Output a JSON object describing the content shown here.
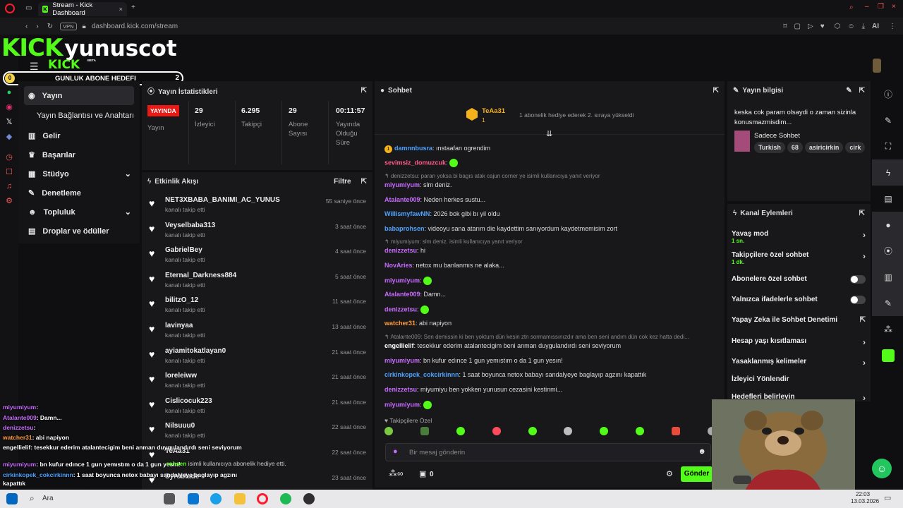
{
  "browser": {
    "tab_title": "Stream - Kick Dashboard",
    "vpn_label": "VPN",
    "url": "dashboard.kick.com/stream",
    "ai_label": "AI"
  },
  "overlay": {
    "brand_logo": "KICK",
    "channel_name": "yunuscot",
    "brand_sub": "KICK",
    "beta_label": "BETA",
    "goal_label": "GUNLUK ABONE HEDEFI",
    "goal_current": "0",
    "goal_target": "2"
  },
  "nav": {
    "items": [
      {
        "label": "Yayın",
        "icon": "radio-icon"
      },
      {
        "label": "Yayın Bağlantısı ve Anahtarı",
        "icon": ""
      },
      {
        "label": "Gelir",
        "icon": "chart-icon"
      },
      {
        "label": "Başarılar",
        "icon": "trophy-icon"
      },
      {
        "label": "Stüdyo",
        "icon": "grid-icon"
      },
      {
        "label": "Denetleme",
        "icon": "wrench-icon"
      },
      {
        "label": "Topluluk",
        "icon": "people-icon"
      },
      {
        "label": "Droplar ve ödüller",
        "icon": "gift-icon"
      }
    ]
  },
  "stats_panel": {
    "title": "Yayın İstatistikleri",
    "live_badge": "YAYINDA",
    "live_label": "Yayın",
    "viewers_value": "29",
    "viewers_label": "İzleyici",
    "followers_value": "6.295",
    "followers_label": "Takipçi",
    "subs_value": "29",
    "subs_label": "Abone Sayısı",
    "uptime_value": "00:11:57",
    "uptime_label": "Yayında Olduğu Süre"
  },
  "activity": {
    "title": "Etkinlik Akışı",
    "filter_label": "Filtre",
    "items": [
      {
        "name": "NET3XBABA_BANIMI_AC_YUNUS",
        "action": "kanalı takip etti",
        "time": "55 saniye önce"
      },
      {
        "name": "Veyselbaba313",
        "action": "kanalı takip etti",
        "time": "3 saat önce"
      },
      {
        "name": "GabrielBey",
        "action": "kanalı takip etti",
        "time": "4 saat önce"
      },
      {
        "name": "Eternal_Darkness884",
        "action": "kanalı takip etti",
        "time": "5 saat önce"
      },
      {
        "name": "bilitzO_12",
        "action": "kanalı takip etti",
        "time": "11 saat önce"
      },
      {
        "name": "lavinyaa",
        "action": "kanalı takip etti",
        "time": "13 saat önce"
      },
      {
        "name": "ayiamitokatlayan0",
        "action": "kanalı takip etti",
        "time": "21 saat önce"
      },
      {
        "name": "loreleiww",
        "action": "kanalı takip etti",
        "time": "21 saat önce"
      },
      {
        "name": "Cislicocuk223",
        "action": "kanalı takip etti",
        "time": "21 saat önce"
      },
      {
        "name": "Nilsuuu0",
        "action": "kanalı takip etti",
        "time": "22 saat önce"
      },
      {
        "name": "TeAa31",
        "action": "",
        "time": "22 saat önce"
      },
      {
        "name": "Syroblade",
        "action": "",
        "time": "23 saat önce"
      }
    ],
    "gift_line_user": "rohsen",
    "gift_line_text": "isimli kullanıcıya abonelik hediye etti."
  },
  "chat": {
    "title": "Sohbet",
    "pinned_user": "TeAa31",
    "pinned_count": "1",
    "pinned_text": "1 abonelik hediye ederek 2. sıraya yükseldi",
    "messages": [
      {
        "badge": "1",
        "user": "damnnbusra",
        "color": "#4da3ff",
        "text": ": ınstaafan ogrendim"
      },
      {
        "user": "sevimsiz_domuzcuk",
        "color": "#ff5b8a",
        "text": ":"
      },
      {
        "reply": "denizzetsu: paran yoksa bi bagıs atak cajun corner ye isimli kullanıcıya yanıt veriyor"
      },
      {
        "user": "miyumiyum",
        "color": "#c86bff",
        "text": ": slm deniz."
      },
      {
        "user": "Atalante009",
        "color": "#c86bff",
        "text": ": Neden herkes sustu..."
      },
      {
        "user": "WillismyfawNN",
        "color": "#4da3ff",
        "text": ": 2026 bok gibi bı yil oldu"
      },
      {
        "user": "babaprohsen",
        "color": "#4da3ff",
        "text": ": videoyu sana atarım die kaydettim sanıyordum kaydetmemisim zort"
      },
      {
        "reply": "miyumiyum: slm deniz. isimli kullanıcıya yanıt veriyor"
      },
      {
        "user": "denizzetsu",
        "color": "#c86bff",
        "text": ": hi"
      },
      {
        "user": "NovAries",
        "color": "#c86bff",
        "text": ": netox mu banlanmıs ne alaka..."
      },
      {
        "user": "miyumiyum",
        "color": "#c86bff",
        "text": ":"
      },
      {
        "user": "Atalante009",
        "color": "#c86bff",
        "text": ": Damn..."
      },
      {
        "user": "denizzetsu",
        "color": "#c86bff",
        "text": ":"
      },
      {
        "user": "watcher31",
        "color": "#ff9a3c",
        "text": ": abi napiyon"
      },
      {
        "reply": "Atalante009: Sen demissin ki ben yoktum dün kesin ztn sormamıssınızdır ama ben seni andım dün cok kez hatta dedi..."
      },
      {
        "user": "engellielif",
        "color": "#ffffff",
        "text": ": tesekkur ederim atalantecigim beni anman duygulandırdı seni seviyorum"
      },
      {
        "user": "miyumiyum",
        "color": "#c86bff",
        "text": ": bn kufur edınce 1 gun yemıstım o da 1 gun yesın!"
      },
      {
        "user": "cirkinkopek_cokcirkinnn",
        "color": "#4da3ff",
        "text": ": 1 saat boyunca netox babayı sandalyeye baglayıp agzını kapattık"
      },
      {
        "user": "denizzetsu",
        "color": "#c86bff",
        "text": ": miyumiyu ben yokken yunusun cezasini kestinmi..."
      },
      {
        "user": "miyumiyum",
        "color": "#c86bff",
        "text": ":"
      }
    ],
    "followers_only_label": "Takipçilere Özel",
    "input_placeholder": "Bir mesaj gönderin",
    "points": "0",
    "send_label": "Gönder"
  },
  "stream_info": {
    "title": "Yayın bilgisi",
    "stream_title": "keska cok param olsaydi o zaman sizinla konusmazmisdim...",
    "category": "Sadece Sohbet",
    "tags": [
      "Turkish",
      "68",
      "asiricirkin",
      "cirk"
    ]
  },
  "channel_actions": {
    "title": "Kanal Eylemleri",
    "rows": [
      {
        "label": "Yavaş mod",
        "sub": "1 sn.",
        "control": "chevron"
      },
      {
        "label": "Takipçilere özel sohbet",
        "sub": "1 dk.",
        "control": "chevron"
      },
      {
        "label": "Abonelere özel sohbet",
        "sub": "",
        "control": "toggle"
      },
      {
        "label": "Yalnızca ifadelerle sohbet",
        "sub": "",
        "control": "toggle"
      },
      {
        "label": "Yapay Zeka ile Sohbet Denetimi",
        "sub": "",
        "control": "external"
      },
      {
        "label": "Hesap yaşı kısıtlaması",
        "sub": "",
        "control": "chevron"
      },
      {
        "label": "Yasaklanmış kelimeler",
        "sub": "",
        "control": "chevron"
      },
      {
        "label": "İzleyici Yönlendir",
        "sub": "",
        "control": "none"
      },
      {
        "label": "Hedefleri belirleyin",
        "sub": "",
        "control": "chevron"
      }
    ]
  },
  "overlay_chat": [
    {
      "user": "miyumiyum",
      "color": "#c86bff",
      "text": ":"
    },
    {
      "user": "Atalante009",
      "color": "#c86bff",
      "text": ": Damn..."
    },
    {
      "user": "denizzetsu",
      "color": "#c86bff",
      "text": ":"
    },
    {
      "user": "watcher31",
      "color": "#ff9a3c",
      "text": ": abi napiyon"
    },
    {
      "user": "engellielif",
      "color": "#ffffff",
      "text": ": tesekkur ederim atalantecigim beni anman duygulandırdı seni seviyorum"
    },
    {
      "user": "miyumiyum",
      "color": "#c86bff",
      "text": ": bn kufur edınce 1 gun yemıstım o da 1 gun yesın!"
    },
    {
      "user": "cirkinkopek_cokcirkinnn",
      "color": "#4da3ff",
      "text": ": 1 saat boyunca netox babayı sandalyeye baglayıp agzını"
    },
    {
      "user": "",
      "color": "#ffffff",
      "text": "kapattık"
    },
    {
      "user": "denizzetsu",
      "color": "#c86bff",
      "text": ": miyumiyu ben yokken yunusun cezasini kestinmi..."
    },
    {
      "user": "miyumiyum",
      "color": "#c86bff",
      "text": ""
    }
  ],
  "taskbar": {
    "search_label": "Ara",
    "time": "22:03",
    "date": "13.03.2026"
  }
}
